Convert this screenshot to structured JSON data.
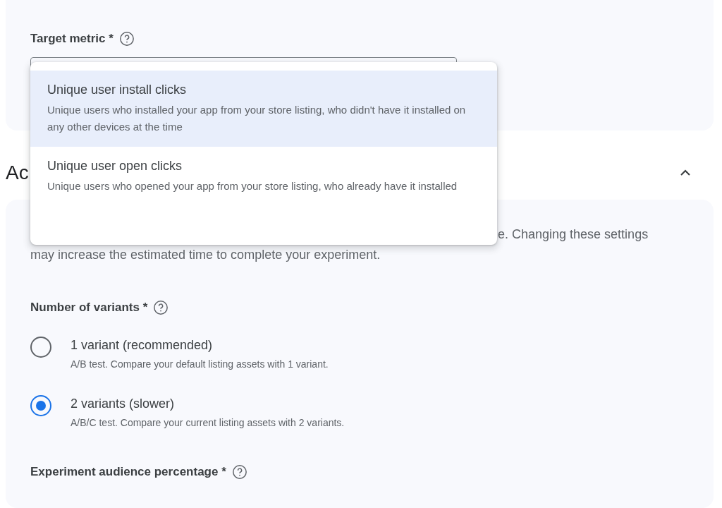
{
  "target_metric": {
    "label": "Target metric *",
    "menu": {
      "options": [
        {
          "title": "Unique user install clicks",
          "description": "Unique users who installed your app from your store listing, who didn't have it installed on any other devices at the time",
          "selected": true
        },
        {
          "title": "Unique user open clicks",
          "description": "Unique users who opened your app from your store listing, who already have it installed",
          "selected": false
        }
      ]
    }
  },
  "advanced_section": {
    "heading": "Ac",
    "expanded": true,
    "intro_lines": [
      "e. Changing these settings",
      "may increase the estimated time to complete your experiment."
    ],
    "number_of_variants": {
      "label": "Number of variants *",
      "options": [
        {
          "title": "1 variant (recommended)",
          "description": "A/B test. Compare your default listing assets with 1 variant.",
          "selected": false
        },
        {
          "title": "2 variants (slower)",
          "description": "A/B/C test. Compare your current listing assets with 2 variants.",
          "selected": true
        }
      ]
    },
    "audience": {
      "label": "Experiment audience percentage *"
    }
  }
}
